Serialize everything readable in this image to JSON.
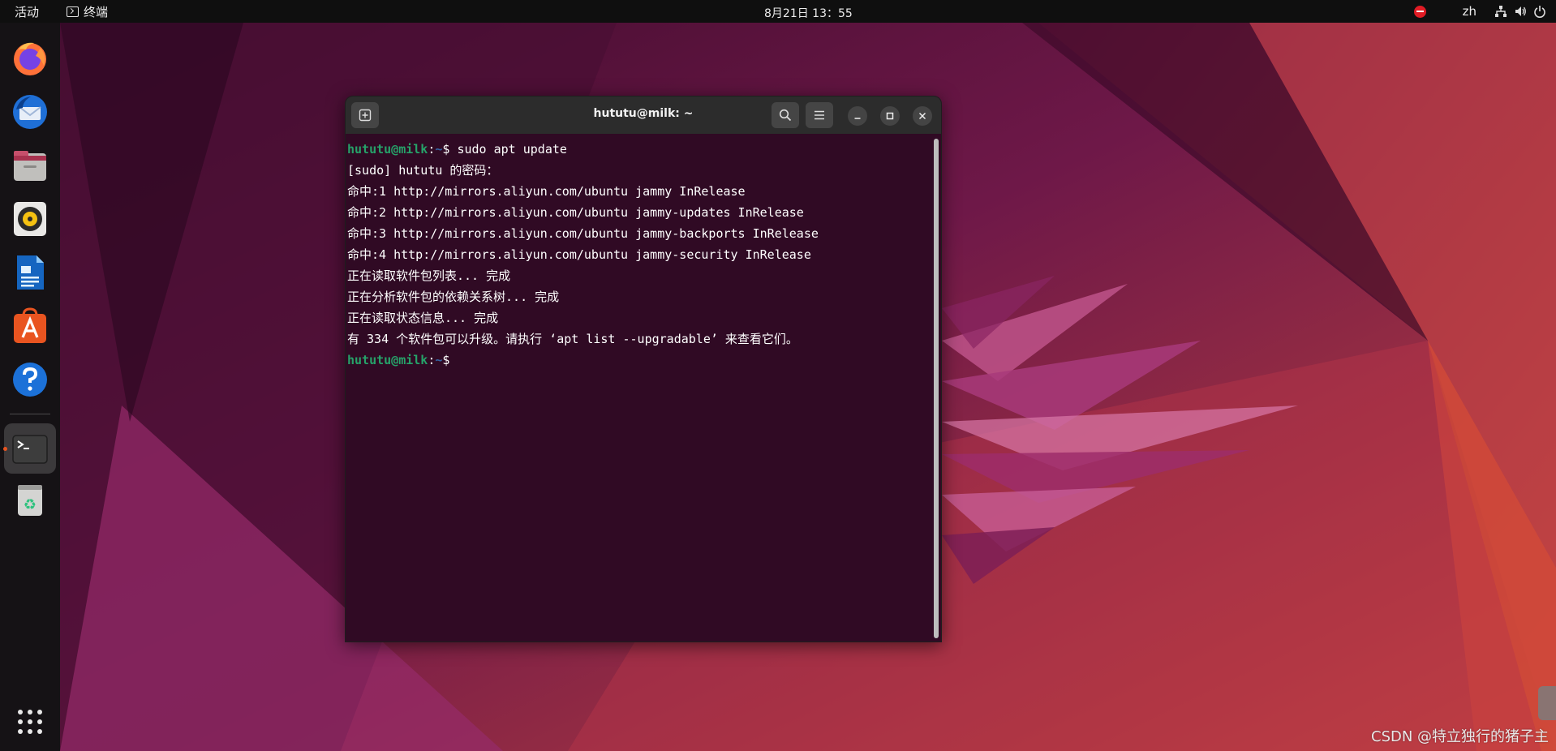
{
  "topbar": {
    "activities": "活动",
    "app_name": "终端",
    "clock": "8月21日  13：55",
    "input_method": "zh",
    "icons": [
      "do-not-disturb-icon",
      "network-icon",
      "volume-icon",
      "power-icon"
    ]
  },
  "dock": {
    "items": [
      {
        "name": "firefox",
        "icon": "firefox-icon"
      },
      {
        "name": "thunderbird",
        "icon": "thunderbird-icon"
      },
      {
        "name": "files",
        "icon": "files-icon"
      },
      {
        "name": "rhythmbox",
        "icon": "rhythmbox-icon"
      },
      {
        "name": "libreoffice-writer",
        "icon": "writer-icon"
      },
      {
        "name": "software",
        "icon": "software-center-icon"
      },
      {
        "name": "help",
        "icon": "help-icon"
      },
      {
        "name": "terminal",
        "icon": "terminal-icon",
        "running": true
      },
      {
        "name": "trash",
        "icon": "trash-icon"
      }
    ],
    "show_apps_icon": "app-grid-icon"
  },
  "terminal": {
    "title": "hututu@milk: ~",
    "prompt_user": "hututu@milk",
    "prompt_sep": ":",
    "prompt_path": "~",
    "prompt_symbol": "$",
    "command": " sudo apt update",
    "output": [
      "[sudo] hututu 的密码：",
      "命中:1 http://mirrors.aliyun.com/ubuntu jammy InRelease",
      "命中:2 http://mirrors.aliyun.com/ubuntu jammy-updates InRelease",
      "命中:3 http://mirrors.aliyun.com/ubuntu jammy-backports InRelease",
      "命中:4 http://mirrors.aliyun.com/ubuntu jammy-security InRelease",
      "正在读取软件包列表... 完成",
      "正在分析软件包的依赖关系树... 完成",
      "正在读取状态信息... 完成",
      "有 334 个软件包可以升级。请执行 ‘apt list --upgradable’ 来查看它们。"
    ],
    "colors": {
      "background": "#300a24",
      "prompt_user": "#26a269",
      "prompt_path": "#3465a4"
    }
  },
  "watermark": "CSDN @特立独行的猪子",
  "watermark_tail": "主"
}
